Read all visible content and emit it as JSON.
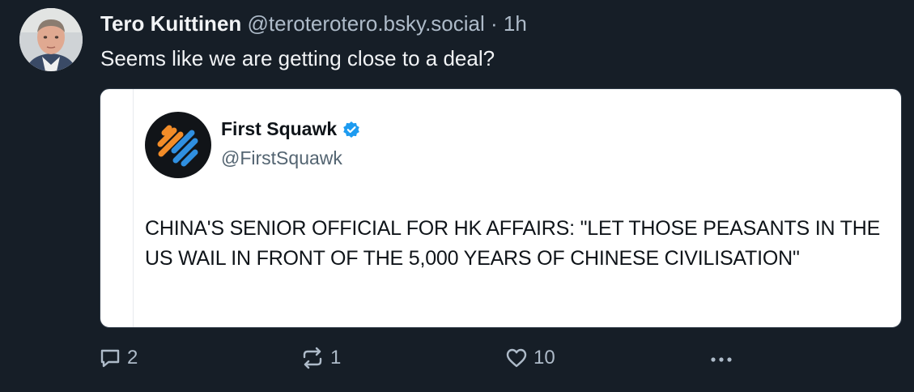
{
  "post": {
    "display_name": "Tero Kuittinen",
    "handle": "@teroterotero.bsky.social",
    "separator": "·",
    "time": "1h",
    "text": "Seems like we are getting close to a deal?"
  },
  "embed": {
    "name": "First Squawk",
    "handle": "@FirstSquawk",
    "text": "CHINA'S SENIOR OFFICIAL FOR HK AFFAIRS: \"LET THOSE PEASANTS IN THE US WAIL IN FRONT OF THE 5,000 YEARS OF CHINESE CIVILISATION\"",
    "verified_icon": "verified-badge-icon",
    "verified_color": "#1d9bf0"
  },
  "actions": {
    "reply_count": "2",
    "repost_count": "1",
    "like_count": "10",
    "reply_icon": "reply-icon",
    "repost_icon": "repost-icon",
    "like_icon": "heart-icon",
    "more_icon": "more-icon"
  },
  "colors": {
    "background": "#161e27",
    "text": "#f1f3f5",
    "muted": "#aebbc9",
    "logo_orange": "#f28c28",
    "logo_blue": "#2f8fe0"
  }
}
